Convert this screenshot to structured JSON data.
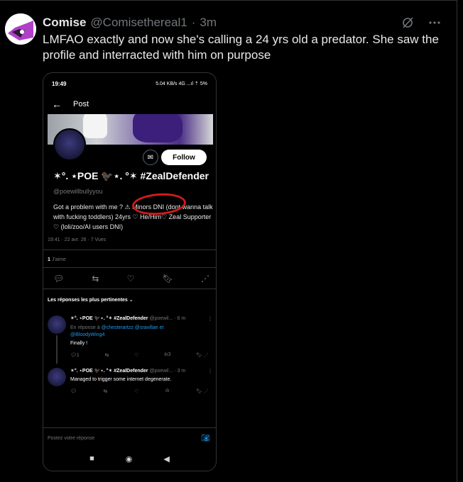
{
  "post": {
    "display_name": "Comise",
    "handle": "@Comisethereal1",
    "separator": "·",
    "time": "3m",
    "text": "LMFAO exactly and now she's calling a 24 yrs old a predator. She saw the profile and interracted with him on purpose",
    "icons": {
      "grok": "grok-icon",
      "more": "more-icon"
    }
  },
  "phone": {
    "status": {
      "time": "19:49",
      "right": "5.04 KB/s 4G ...ıl ⇡ 5%"
    },
    "nav_title": "Post",
    "profile": {
      "follow_label": "Follow",
      "name": "✶°. ⋆POE 🐦‍⬛⋆. °✶ #ZealDefender",
      "handle": "@poewillbullyyou",
      "bio": "Got a problem with me ? ⚠ Minors DNI (dont wanna talk with fucking toddlers) 24yrs ♡ He/Him♡ Zeal Supporter ♡ (loli/zoo/AI users DNI)"
    },
    "meta": "19:41 · 22 avr. 26 · 7 Vues",
    "likes_count": "1",
    "likes_label": "J'aime",
    "sort_label": "Les réponses les plus pertinentes",
    "replies": [
      {
        "name": "✶°. ⋆POE 🐦‍⬛⋆. °✶ #ZealDefender",
        "handle": "@poewil...",
        "time": "· 6 m",
        "reply_to_prefix": "En réponse à",
        "reply_to": "@chesterartzz @sravillae et @BloodyWing4",
        "text": "Finally !",
        "replies": "1",
        "views": "3"
      },
      {
        "name": "✶°. ⋆POE 🐦‍⬛⋆. °✶ #ZealDefender",
        "handle": "@poewil...",
        "time": "· 3 m",
        "text": "Managed to trigger some internet degenerate.",
        "replies": "",
        "views": ""
      }
    ],
    "compose_placeholder": "Postez votre réponse"
  }
}
